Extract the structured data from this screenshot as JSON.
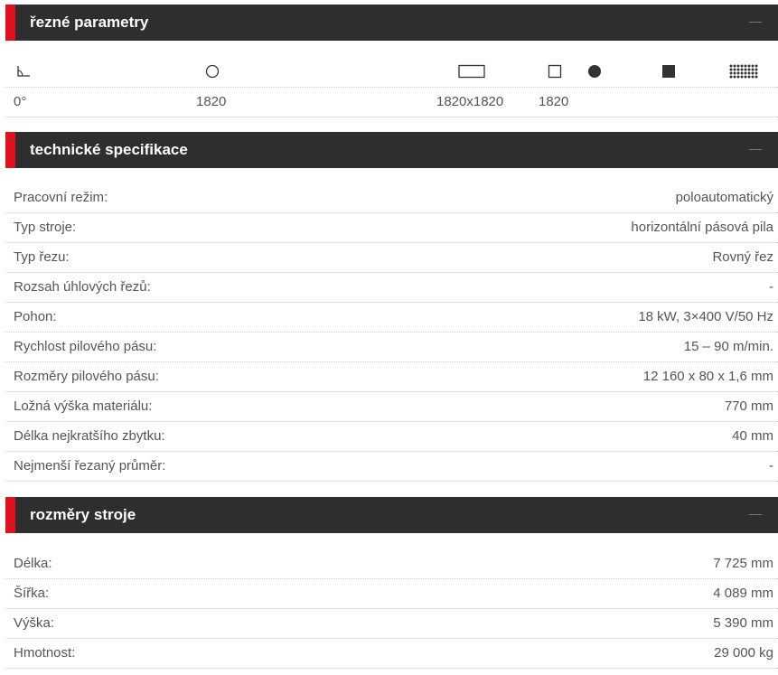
{
  "sections": {
    "cutting": {
      "title": "řezné parametry"
    },
    "tech": {
      "title": "technické specifikace"
    },
    "dims": {
      "title": "rozměry stroje"
    }
  },
  "cutting_params": [
    {
      "icon": "angle-icon",
      "value": "0°"
    },
    {
      "icon": "round-bar-icon",
      "value": "1820"
    },
    {
      "icon": "rectangle-bar-icon",
      "value": "1820x1820"
    },
    {
      "icon": "square-bar-icon",
      "value": "1820"
    },
    {
      "icon": "filled-round-bar-icon",
      "value": ""
    },
    {
      "icon": "filled-square-bar-icon",
      "value": ""
    },
    {
      "icon": "bundle-icon",
      "value": ""
    }
  ],
  "tech_specs": [
    {
      "label": "Pracovní režim:",
      "value": "poloautomatický"
    },
    {
      "label": "Typ stroje:",
      "value": "horizontální pásová pila"
    },
    {
      "label": "Typ řezu:",
      "value": "Rovný řez"
    },
    {
      "label": "Rozsah úhlových řezů:",
      "value": "-"
    },
    {
      "label": "Pohon:",
      "value": "18 kW, 3×400 V/50 Hz"
    },
    {
      "label": "Rychlost pilového pásu:",
      "value": "15 – 90 m/min."
    },
    {
      "label": "Rozměry pilového pásu:",
      "value": "12 160 x 80 x 1,6 mm"
    },
    {
      "label": "Ložná výška materiálu:",
      "value": "770 mm"
    },
    {
      "label": "Délka nejkratšího zbytku:",
      "value": "40 mm"
    },
    {
      "label": "Nejmenší řezaný průměr:",
      "value": "-"
    }
  ],
  "dimensions": [
    {
      "label": "Délka:",
      "value": "7 725 mm"
    },
    {
      "label": "Šířka:",
      "value": "4 089 mm"
    },
    {
      "label": "Výška:",
      "value": "5 390 mm"
    },
    {
      "label": "Hmotnost:",
      "value": "29 000 kg"
    }
  ],
  "colors": {
    "header_bg": "#2e2e2e",
    "accent": "#e0101e",
    "text": "#555555"
  }
}
